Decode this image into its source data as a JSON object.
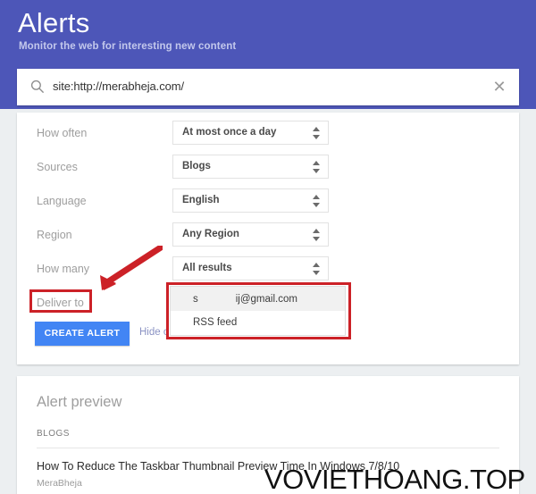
{
  "header": {
    "title": "Alerts",
    "subtitle": "Monitor the web for interesting new content",
    "bg_color": "#4d56b8"
  },
  "search": {
    "value": "site:http://merabheja.com/",
    "search_icon": "search-icon",
    "clear_icon": "close-icon",
    "clear_glyph": "✕"
  },
  "options": {
    "rows": [
      {
        "label": "How often",
        "value": "At most once a day"
      },
      {
        "label": "Sources",
        "value": "Blogs"
      },
      {
        "label": "Language",
        "value": "English"
      },
      {
        "label": "Region",
        "value": "Any Region"
      },
      {
        "label": "How many",
        "value": "All results"
      }
    ],
    "deliver_label": "Deliver to",
    "deliver_options": [
      {
        "prefix": "s",
        "suffix": "ij@gmail.com",
        "redacted": true,
        "selected": true
      },
      {
        "text": "RSS feed",
        "redacted": false,
        "selected": false
      }
    ],
    "create_button": "CREATE ALERT",
    "hide_options_link": "Hide o"
  },
  "preview": {
    "title": "Alert preview",
    "kicker": "BLOGS",
    "headline": "How To Reduce The Taskbar Thumbnail Preview Time In Windows 7/8/10",
    "source": "MeraBheja"
  },
  "annotations": {
    "color": "#cc2127",
    "arrow_icon": "red-arrow-icon",
    "box_deliver": "highlight-deliver-to",
    "box_list": "highlight-deliver-list"
  },
  "watermark": {
    "text": "VOVIETHOANG.TOP"
  }
}
